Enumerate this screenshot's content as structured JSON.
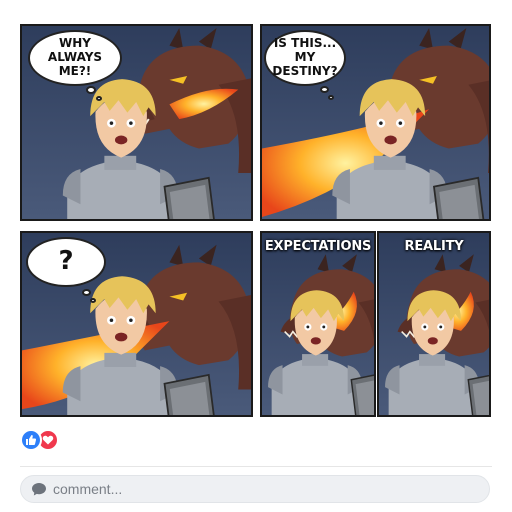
{
  "comic": {
    "panel1": {
      "thought": "WHY ALWAYS\nME?!"
    },
    "panel2": {
      "thought": "IS THIS...\nMY DESTINY?"
    },
    "panel3": {
      "thought": "?"
    },
    "panel4": {
      "caption": "EXPECTATIONS"
    },
    "panel5": {
      "caption": "REALITY"
    }
  },
  "reactions": {
    "like_icon": "thumbs-up-icon",
    "love_icon": "heart-icon",
    "like_color": "#2d7ff9",
    "love_color": "#f0384d"
  },
  "comment": {
    "placeholder": "comment..."
  }
}
